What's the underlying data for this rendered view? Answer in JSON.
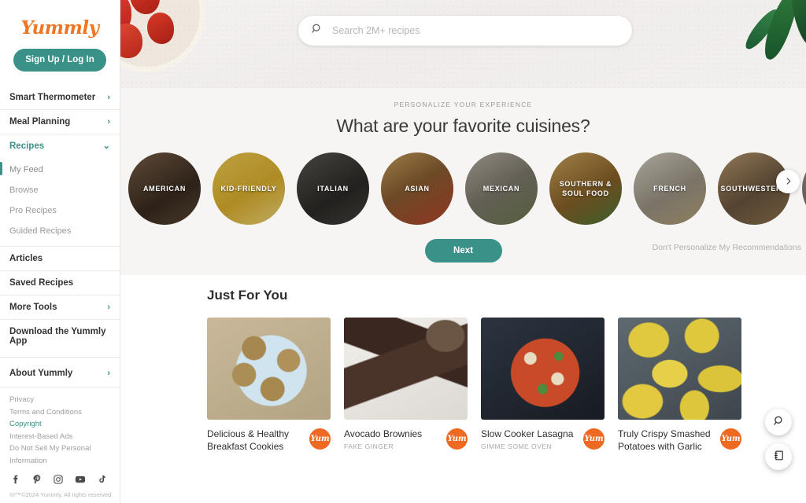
{
  "sidebar": {
    "logo": "Yummly",
    "signup_label": "Sign Up / Log In",
    "nav": [
      {
        "label": "Smart Thermometer",
        "icon": "chevron-right-icon"
      },
      {
        "label": "Meal Planning",
        "icon": "chevron-right-icon"
      },
      {
        "label": "Recipes",
        "icon": "chevron-down-icon",
        "accent": true
      }
    ],
    "subnav": [
      {
        "label": "My Feed",
        "active": true
      },
      {
        "label": "Browse",
        "active": false
      },
      {
        "label": "Pro Recipes",
        "active": false
      },
      {
        "label": "Guided Recipes",
        "active": false
      }
    ],
    "nav2": [
      {
        "label": "Articles"
      },
      {
        "label": "Saved Recipes"
      },
      {
        "label": "More Tools",
        "icon": "chevron-right-icon"
      },
      {
        "label": "Download the Yummly App"
      }
    ],
    "about_label": "About Yummly",
    "about_icon": "chevron-right-icon",
    "legal": [
      {
        "label": "Privacy",
        "highlight": false
      },
      {
        "label": "Terms and Conditions",
        "highlight": false
      },
      {
        "label": "Copyright",
        "highlight": true
      },
      {
        "label": "Interest-Based Ads",
        "highlight": false
      },
      {
        "label": "Do Not Sell My Personal Information",
        "highlight": false
      }
    ],
    "socials": [
      "facebook-icon",
      "pinterest-icon",
      "instagram-icon",
      "youtube-icon",
      "tiktok-icon"
    ],
    "copyright": "®/™©2024 Yummly. All rights reserved."
  },
  "search": {
    "placeholder": "Search 2M+ recipes",
    "value": "",
    "icon": "search-icon"
  },
  "personalize": {
    "kicker": "PERSONALIZE YOUR EXPERIENCE",
    "headline": "What are your favorite cuisines?",
    "next_label": "Next",
    "skip_label": "Don't Personalize My Recommendations",
    "carousel_next_icon": "chevron-right-icon",
    "cuisines": [
      {
        "label": "AMERICAN"
      },
      {
        "label": "KID-FRIENDLY"
      },
      {
        "label": "ITALIAN"
      },
      {
        "label": "ASIAN"
      },
      {
        "label": "MEXICAN"
      },
      {
        "label": "SOUTHERN &\nSOUL FOOD"
      },
      {
        "label": "FRENCH"
      },
      {
        "label": "SOUTHWESTERN"
      }
    ]
  },
  "feed": {
    "title": "Just For You",
    "cards": [
      {
        "title": "Delicious & Healthy Breakfast Cookies",
        "source": "",
        "yum_label": "Yum"
      },
      {
        "title": "Avocado Brownies",
        "source": "FAKE GINGER",
        "yum_label": "Yum"
      },
      {
        "title": "Slow Cooker Lasagna",
        "source": "GIMME SOME OVEN",
        "yum_label": "Yum"
      },
      {
        "title": "Truly Crispy Smashed Potatoes with Garlic",
        "source": "",
        "yum_label": "Yum"
      }
    ]
  },
  "fabs": [
    {
      "icon": "search-icon"
    },
    {
      "icon": "recipe-box-icon"
    }
  ],
  "colors": {
    "teal": "#3a9188",
    "orange": "#ee7622",
    "yum_orange": "#ee6a22",
    "text": "#333333",
    "muted": "#a0a0a0"
  }
}
